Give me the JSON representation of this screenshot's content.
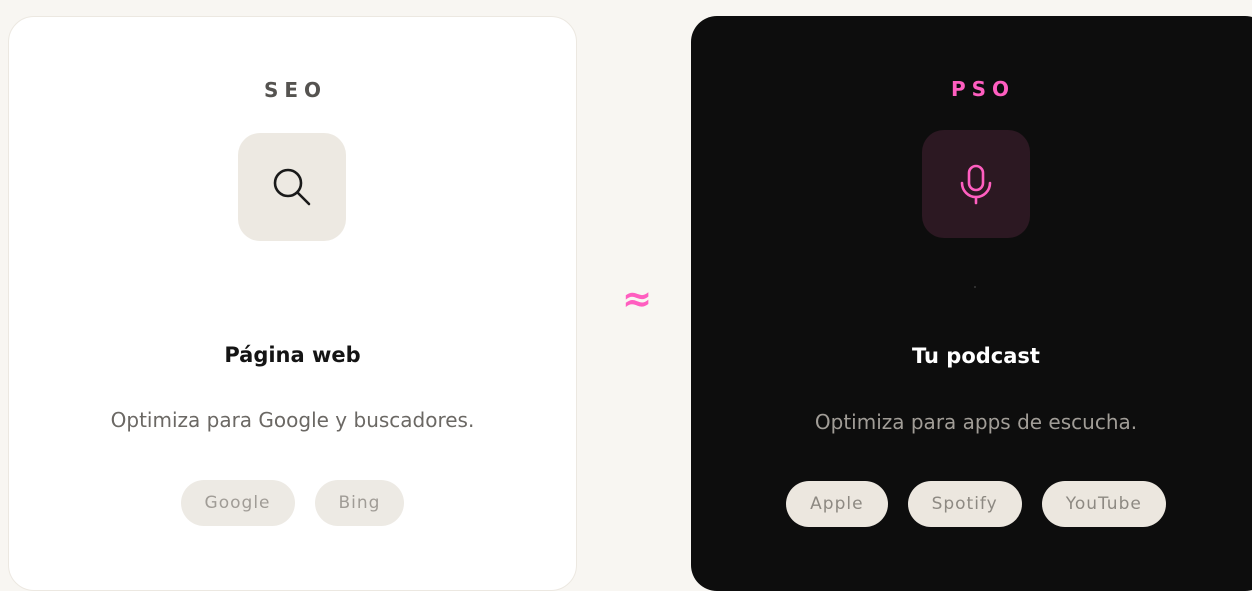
{
  "colors": {
    "background": "#f8f6f2",
    "accent": "#ff5ec0",
    "light_card": "#ffffff",
    "dark_card": "#0d0d0d"
  },
  "seo": {
    "label": "SEO",
    "icon": "search-icon",
    "title": "Página web",
    "description": "Optimiza para Google y buscadores.",
    "chips": [
      "Google",
      "Bing"
    ]
  },
  "connector": {
    "symbol": "≈"
  },
  "pso": {
    "label": "PSO",
    "icon": "microphone-icon",
    "title": "Tu podcast",
    "description": "Optimiza para apps de escucha.",
    "chips": [
      "Apple",
      "Spotify",
      "YouTube"
    ]
  }
}
